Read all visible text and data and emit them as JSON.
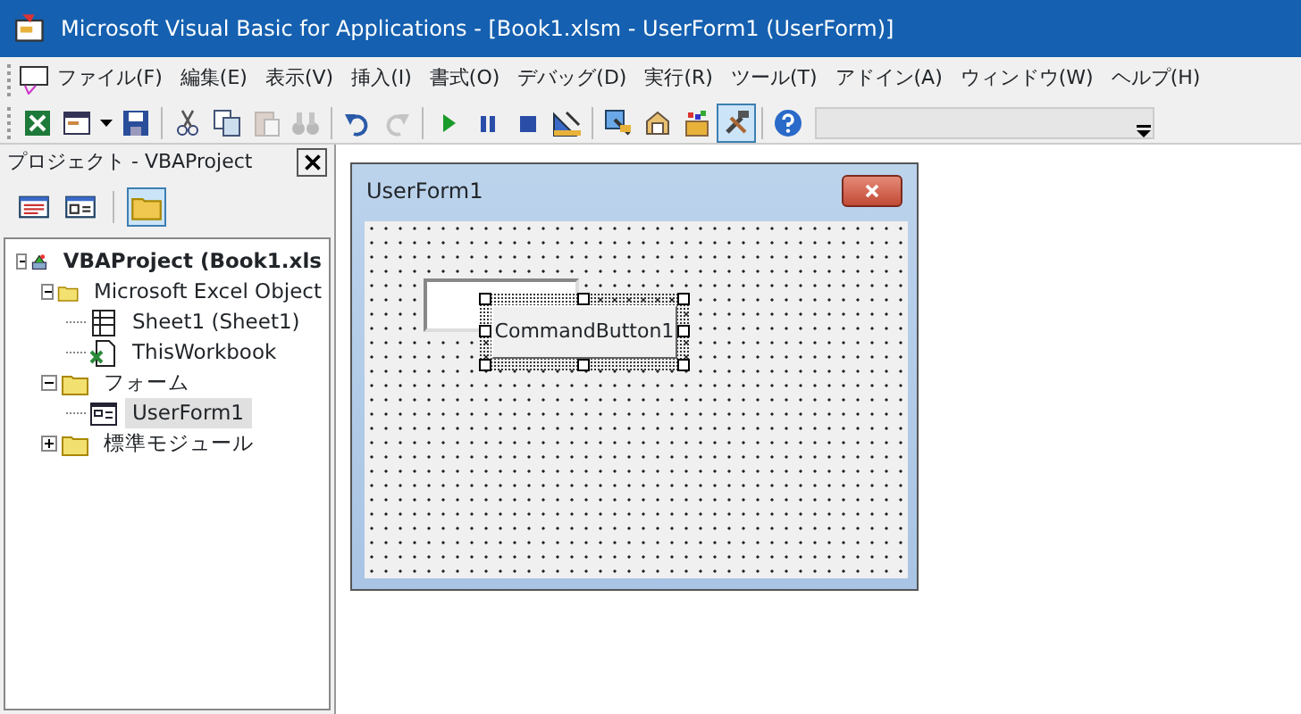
{
  "window": {
    "title": "Microsoft Visual Basic for Applications - [Book1.xlsm - UserForm1 (UserForm)]"
  },
  "menu": [
    "ファイル(F)",
    "編集(E)",
    "表示(V)",
    "挿入(I)",
    "書式(O)",
    "デバッグ(D)",
    "実行(R)",
    "ツール(T)",
    "アドイン(A)",
    "ウィンドウ(W)",
    "ヘルプ(H)"
  ],
  "toolbar": [
    {
      "kind": "excel",
      "disabled": false,
      "pressed": false
    },
    {
      "kind": "insert",
      "disabled": false,
      "pressed": false
    },
    {
      "kind": "save",
      "disabled": false,
      "pressed": false
    },
    {
      "kind": "sep"
    },
    {
      "kind": "cut",
      "disabled": false,
      "pressed": false
    },
    {
      "kind": "copy",
      "disabled": false,
      "pressed": false
    },
    {
      "kind": "paste",
      "disabled": true,
      "pressed": false
    },
    {
      "kind": "find",
      "disabled": true,
      "pressed": false
    },
    {
      "kind": "sep"
    },
    {
      "kind": "undo",
      "disabled": false,
      "pressed": false
    },
    {
      "kind": "redo",
      "disabled": true,
      "pressed": false
    },
    {
      "kind": "sep"
    },
    {
      "kind": "run",
      "disabled": false,
      "pressed": false
    },
    {
      "kind": "pause",
      "disabled": false,
      "pressed": false
    },
    {
      "kind": "stop",
      "disabled": false,
      "pressed": false
    },
    {
      "kind": "design",
      "disabled": false,
      "pressed": false
    },
    {
      "kind": "sep"
    },
    {
      "kind": "explorer",
      "disabled": false,
      "pressed": false
    },
    {
      "kind": "properties",
      "disabled": false,
      "pressed": false
    },
    {
      "kind": "browser",
      "disabled": false,
      "pressed": false
    },
    {
      "kind": "toolbox",
      "disabled": false,
      "pressed": true
    },
    {
      "kind": "sep"
    },
    {
      "kind": "help",
      "disabled": false,
      "pressed": false
    }
  ],
  "project_pane": {
    "title": "プロジェクト - VBAProject",
    "buttons": [
      {
        "kind": "code",
        "pressed": false
      },
      {
        "kind": "object",
        "pressed": false
      },
      {
        "kind": "folders",
        "pressed": true
      }
    ],
    "tree": [
      {
        "label": "VBAProject (Book1.xls",
        "kind": "project",
        "expanded": true,
        "selected": false,
        "children": [
          {
            "label": "Microsoft Excel Object",
            "kind": "folder",
            "expanded": true,
            "selected": false,
            "children": [
              {
                "label": "Sheet1 (Sheet1)",
                "kind": "sheet",
                "selected": false
              },
              {
                "label": "ThisWorkbook",
                "kind": "workbook",
                "selected": false
              }
            ]
          },
          {
            "label": "フォーム",
            "kind": "folder",
            "expanded": true,
            "selected": false,
            "children": [
              {
                "label": "UserForm1",
                "kind": "form",
                "selected": true
              }
            ]
          },
          {
            "label": "標準モジュール",
            "kind": "folder",
            "expanded": false,
            "selected": false
          }
        ]
      }
    ]
  },
  "designer": {
    "form_title": "UserForm1",
    "controls": [
      {
        "kind": "textbox",
        "selected": false
      },
      {
        "kind": "button",
        "label": "CommandButton1",
        "selected": true
      }
    ]
  }
}
